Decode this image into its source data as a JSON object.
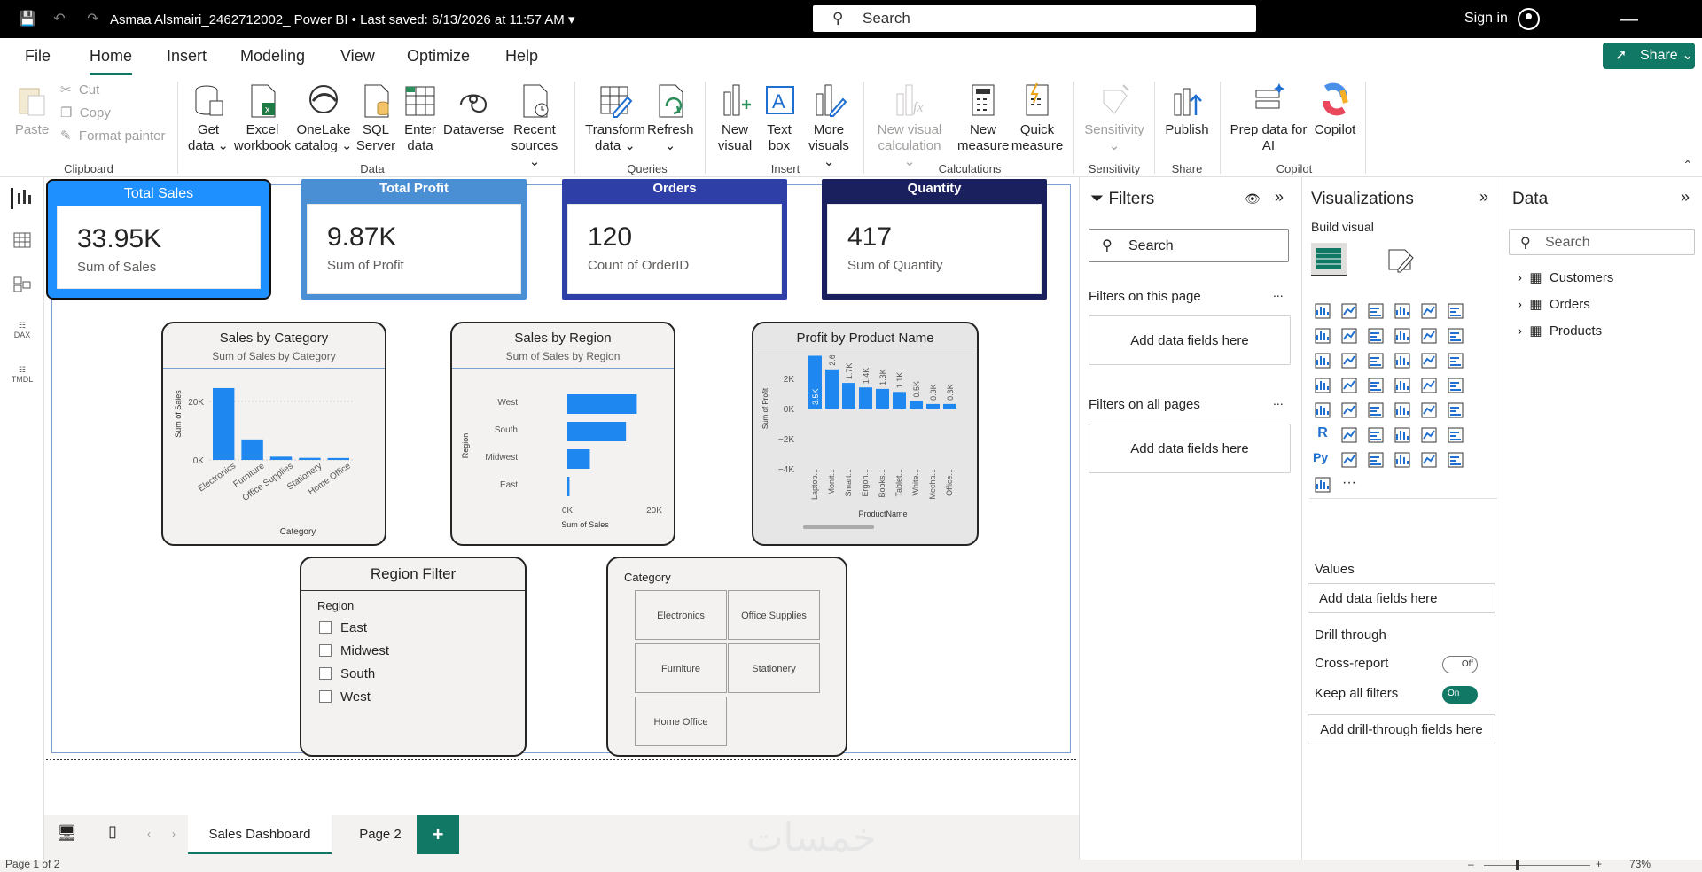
{
  "titlebar": {
    "title": "Asmaa Alsmairi_2462712002_ Power BI • Last saved: 6/13/2026 at 11:57 AM",
    "search_placeholder": "Search",
    "signin": "Sign in"
  },
  "menu": {
    "items": [
      "File",
      "Home",
      "Insert",
      "Modeling",
      "View",
      "Optimize",
      "Help"
    ],
    "share": "Share"
  },
  "ribbon": {
    "paste": "Paste",
    "cut": "Cut",
    "copy": "Copy",
    "format_painter": "Format painter",
    "get_data": "Get data",
    "excel": "Excel workbook",
    "onelake": "OneLake catalog",
    "sql": "SQL Server",
    "enter_data": "Enter data",
    "dataverse": "Dataverse",
    "recent": "Recent sources",
    "transform": "Transform data",
    "refresh": "Refresh",
    "new_visual": "New visual",
    "text_box": "Text box",
    "more_visuals": "More visuals",
    "new_visual_calc": "New visual calculation",
    "new_measure": "New measure",
    "quick_measure": "Quick measure",
    "sensitivity": "Sensitivity",
    "publish": "Publish",
    "prep_ai": "Prep data for AI",
    "copilot": "Copilot",
    "groups": {
      "clipboard": "Clipboard",
      "data": "Data",
      "queries": "Queries",
      "insert": "Insert",
      "calculations": "Calculations",
      "sensitivity": "Sensitivity",
      "share": "Share",
      "copilot": "Copilot"
    }
  },
  "cards": [
    {
      "title": "Total Sales",
      "value": "33.95K",
      "label": "Sum of Sales"
    },
    {
      "title": "Total Profit",
      "value": "9.87K",
      "label": "Sum of Profit"
    },
    {
      "title": "Orders",
      "value": "120",
      "label": "Count of OrderID"
    },
    {
      "title": "Quantity",
      "value": "417",
      "label": "Sum of Quantity"
    }
  ],
  "chart_data": [
    {
      "type": "bar",
      "title": "Sales by Category",
      "subtitle": "Sum of Sales by Category",
      "xlabel": "Category",
      "ylabel": "Sum of Sales",
      "categories": [
        "Electronics",
        "Furniture",
        "Office Supplies",
        "Stationery",
        "Home Office"
      ],
      "values": [
        24500,
        7000,
        1100,
        700,
        650
      ],
      "yticks": [
        "0K",
        "20K"
      ],
      "ylim": [
        0,
        26000
      ]
    },
    {
      "type": "bar",
      "orientation": "horizontal",
      "title": "Sales by Region",
      "subtitle": "Sum of Sales by Region",
      "xlabel": "Sum of Sales",
      "ylabel": "Region",
      "categories": [
        "West",
        "South",
        "Midwest",
        "East"
      ],
      "values": [
        16000,
        13500,
        5200,
        500
      ],
      "xticks": [
        "0K",
        "20K"
      ],
      "xlim": [
        0,
        20000
      ]
    },
    {
      "type": "bar",
      "title": "Profit by Product Name",
      "xlabel": "ProductName",
      "ylabel": "Sum of Profit",
      "categories": [
        "Laptop...",
        "Monit...",
        "Smart...",
        "Ergon...",
        "Books...",
        "Tablet...",
        "White...",
        "Mecha...",
        "Office..."
      ],
      "values": [
        3500,
        2600,
        1700,
        1400,
        1300,
        1100,
        500,
        300,
        300
      ],
      "data_labels": [
        "3.5K",
        "2.6K",
        "1.7K",
        "1.4K",
        "1.3K",
        "1.1K",
        "0.5K",
        "0.3K",
        "0.3K"
      ],
      "yticks": [
        "4K",
        "2K",
        "0K",
        "−2K",
        "−4K"
      ],
      "ylim": [
        -5000,
        5000
      ]
    }
  ],
  "slicers": {
    "region": {
      "title": "Region Filter",
      "header": "Region",
      "items": [
        "East",
        "Midwest",
        "South",
        "West"
      ]
    },
    "category": {
      "header": "Category",
      "items": [
        "Electronics",
        "Office Supplies",
        "Furniture",
        "Stationery",
        "Home Office"
      ]
    }
  },
  "filters": {
    "title": "Filters",
    "search": "Search",
    "on_page": "Filters on this page",
    "all_pages": "Filters on all pages",
    "add": "Add data fields here",
    "more": "..."
  },
  "visualizations": {
    "title": "Visualizations",
    "build": "Build visual",
    "values": "Values",
    "add": "Add data fields here",
    "drill": "Drill through",
    "cross_report": "Cross-report",
    "cross_state": "Off",
    "keep_filters": "Keep all filters",
    "keep_state": "On",
    "add_drill": "Add drill-through fields here",
    "ellipsis": "···",
    "r_label": "R",
    "py_label": "Py"
  },
  "data_pane": {
    "title": "Data",
    "search": "Search",
    "tables": [
      "Customers",
      "Orders",
      "Products"
    ]
  },
  "tabs": {
    "pages": [
      "Sales Dashboard",
      "Page 2"
    ],
    "add": "+"
  },
  "status": {
    "page": "Page 1 of 2",
    "zoom": "73%"
  },
  "watermark": "خمسات",
  "colors": {
    "accent": "#117865",
    "card1": "#1e90ff",
    "card2": "#4a8fd4",
    "card3": "#2f3fa8",
    "card4": "#1a1f5e",
    "bar": "#1e88f0"
  }
}
